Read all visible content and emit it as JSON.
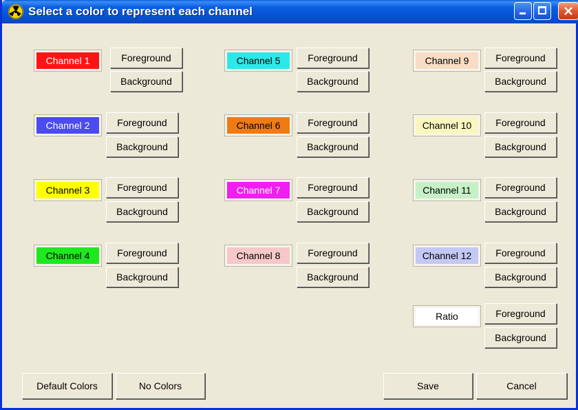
{
  "window": {
    "title": "Select a color to represent each channel"
  },
  "title_buttons": {
    "minimize_icon": "minimize-icon",
    "maximize_icon": "maximize-icon",
    "close_icon": "close-icon"
  },
  "channels": [
    {
      "label": "Channel 1",
      "bg": "#ff1414",
      "fg": "#ffffff",
      "foreground_label": "Foreground",
      "background_label": "Background"
    },
    {
      "label": "Channel 2",
      "bg": "#4b4bef",
      "fg": "#ffffff",
      "foreground_label": "Foreground",
      "background_label": "Background"
    },
    {
      "label": "Channel 3",
      "bg": "#ffff00",
      "fg": "#000000",
      "foreground_label": "Foreground",
      "background_label": "Background"
    },
    {
      "label": "Channel 4",
      "bg": "#1ee81e",
      "fg": "#000000",
      "foreground_label": "Foreground",
      "background_label": "Background"
    },
    {
      "label": "Channel 5",
      "bg": "#2de8e8",
      "fg": "#000000",
      "foreground_label": "Foreground",
      "background_label": "Background"
    },
    {
      "label": "Channel 6",
      "bg": "#f07a14",
      "fg": "#000000",
      "foreground_label": "Foreground",
      "background_label": "Background"
    },
    {
      "label": "Channel 7",
      "bg": "#f01ef0",
      "fg": "#ffffff",
      "foreground_label": "Foreground",
      "background_label": "Background"
    },
    {
      "label": "Channel 8",
      "bg": "#f6c8c8",
      "fg": "#000000",
      "foreground_label": "Foreground",
      "background_label": "Background"
    },
    {
      "label": "Channel 9",
      "bg": "#f8dcc4",
      "fg": "#000000",
      "foreground_label": "Foreground",
      "background_label": "Background"
    },
    {
      "label": "Channel 10",
      "bg": "#fbf6c0",
      "fg": "#000000",
      "foreground_label": "Foreground",
      "background_label": "Background"
    },
    {
      "label": "Channel 11",
      "bg": "#c6f0c6",
      "fg": "#000000",
      "foreground_label": "Foreground",
      "background_label": "Background"
    },
    {
      "label": "Channel 12",
      "bg": "#c4c8f4",
      "fg": "#000000",
      "foreground_label": "Foreground",
      "background_label": "Background"
    },
    {
      "label": "Ratio",
      "bg": "#ffffff",
      "fg": "#000000",
      "foreground_label": "Foreground",
      "background_label": "Background"
    }
  ],
  "footer": {
    "default_colors": "Default Colors",
    "no_colors": "No Colors",
    "save": "Save",
    "cancel": "Cancel"
  },
  "colors": {
    "titlebar": "#0b5fe0",
    "dialog_bg": "#ece9d8",
    "border": "#0831d9"
  }
}
